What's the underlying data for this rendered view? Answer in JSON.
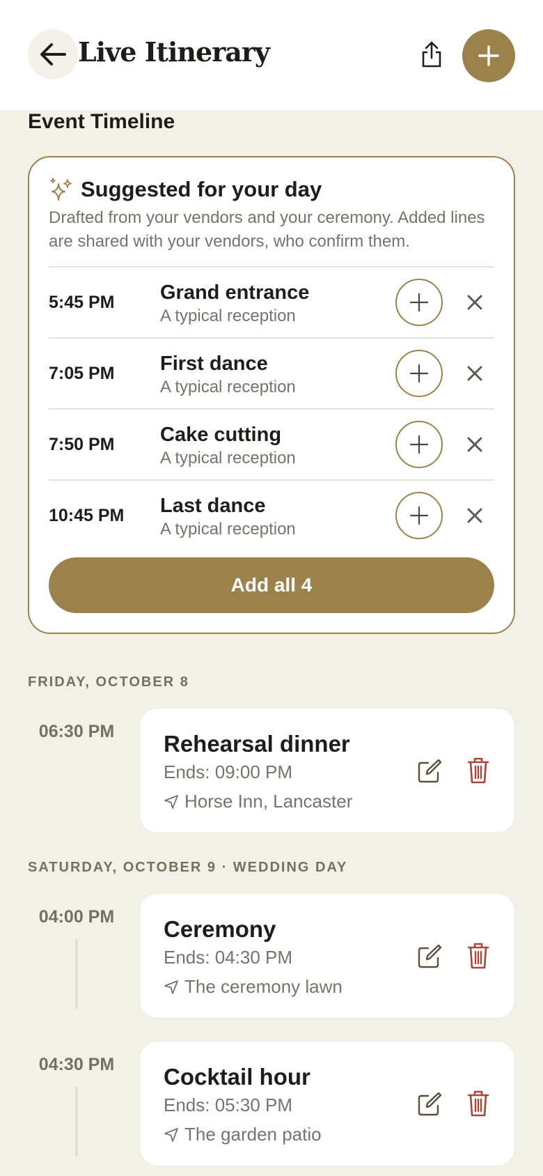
{
  "header": {
    "title": "Live Itinerary",
    "back_icon": "arrow-left-icon",
    "share_icon": "share-icon",
    "add_icon": "plus-icon"
  },
  "section_title": "Event Timeline",
  "suggestions": {
    "title": "Suggested for your day",
    "description": "Drafted from your vendors and your ceremony. Added lines are shared with your vendors, who confirm them.",
    "items": [
      {
        "time": "5:45 PM",
        "name": "Grand entrance",
        "subtitle": "A typical reception"
      },
      {
        "time": "7:05 PM",
        "name": "First dance",
        "subtitle": "A typical reception"
      },
      {
        "time": "7:50 PM",
        "name": "Cake cutting",
        "subtitle": "A typical reception"
      },
      {
        "time": "10:45 PM",
        "name": "Last dance",
        "subtitle": "A typical reception"
      }
    ],
    "add_all_label": "Add all 4"
  },
  "days": [
    {
      "label": "FRIDAY, OCTOBER 8",
      "events": [
        {
          "time": "06:30 PM",
          "title": "Rehearsal dinner",
          "ends": "Ends: 09:00 PM",
          "location": "Horse Inn, Lancaster"
        }
      ]
    },
    {
      "label": "SATURDAY, OCTOBER 9 · WEDDING DAY",
      "events": [
        {
          "time": "04:00 PM",
          "title": "Ceremony",
          "ends": "Ends: 04:30 PM",
          "location": "The ceremony lawn"
        },
        {
          "time": "04:30 PM",
          "title": "Cocktail hour",
          "ends": "Ends: 05:30 PM",
          "location": "The garden patio"
        }
      ]
    }
  ],
  "colors": {
    "accent": "#9b814b",
    "background": "#f1f1e8",
    "danger": "#a8463a"
  }
}
